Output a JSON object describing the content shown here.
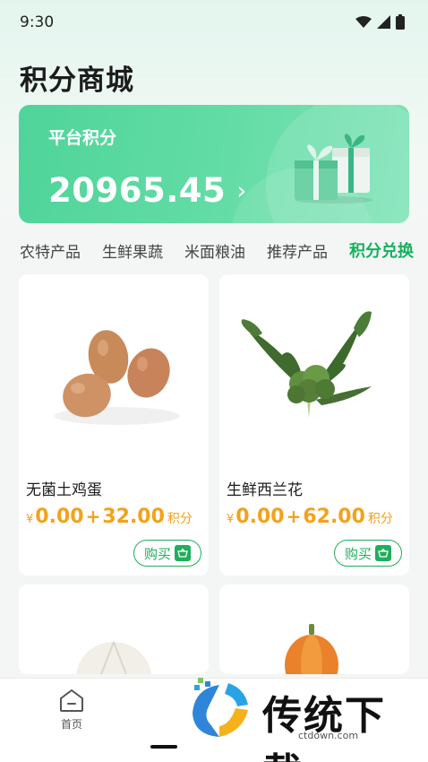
{
  "status_bar": {
    "time": "9:30"
  },
  "page": {
    "title": "积分商城"
  },
  "points_card": {
    "label": "平台积分",
    "value": "20965.45",
    "arrow": "›"
  },
  "tabs": [
    {
      "label": "农特产品",
      "active": false
    },
    {
      "label": "生鲜果蔬",
      "active": false
    },
    {
      "label": "米面粮油",
      "active": false
    },
    {
      "label": "推荐产品",
      "active": false
    },
    {
      "label": "积分兑换",
      "active": true
    }
  ],
  "products": [
    {
      "name": "无菌土鸡蛋",
      "currency": "¥",
      "price": "0.00",
      "plus": "+",
      "points": "32.00",
      "points_unit": "积分",
      "buy_label": "购买"
    },
    {
      "name": "生鲜西兰花",
      "currency": "¥",
      "price": "0.00",
      "plus": "+",
      "points": "62.00",
      "points_unit": "积分",
      "buy_label": "购买"
    }
  ],
  "bottom_nav": {
    "home_label": "首页"
  },
  "watermark": {
    "text": "传统下载",
    "url": "ctdown.com"
  },
  "colors": {
    "accent": "#16b05d",
    "price": "#f2a21b",
    "card_green": "#5fdba3"
  }
}
